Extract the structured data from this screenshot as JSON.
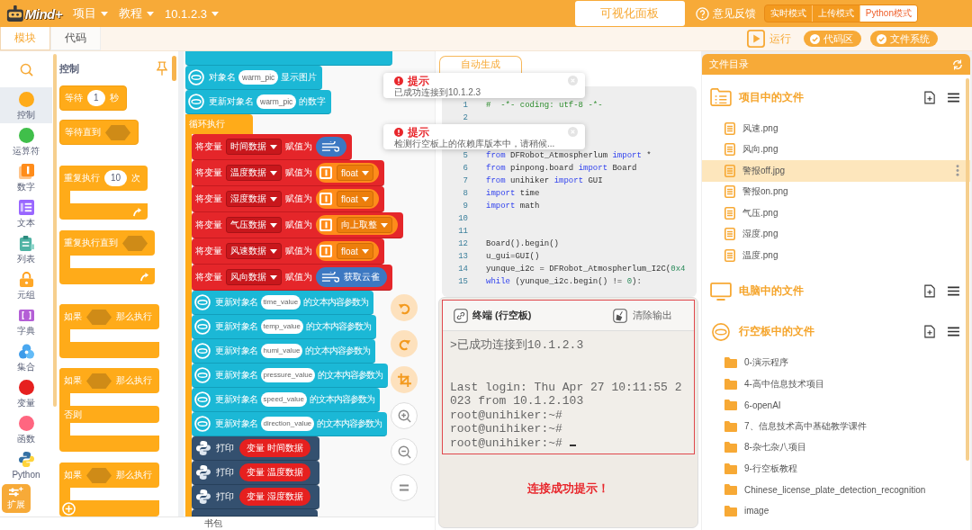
{
  "header": {
    "logo": "Mind+",
    "menus": [
      {
        "label": "项目"
      },
      {
        "label": "教程"
      },
      {
        "label": "10.1.2.3"
      }
    ],
    "panel_button": "可视化面板",
    "feedback": "意见反馈",
    "modes": [
      {
        "label": "实时模式",
        "selected": false
      },
      {
        "label": "上传模式",
        "selected": false
      },
      {
        "label": "Python模式",
        "selected": true
      }
    ]
  },
  "editor_tabs": [
    {
      "label": "模块",
      "selected": true
    },
    {
      "label": "代码",
      "selected": false
    }
  ],
  "toolbar": {
    "run": "运行",
    "toggles": [
      {
        "label": "代码区",
        "checked": true
      },
      {
        "label": "文件系统",
        "checked": true
      }
    ]
  },
  "categories": [
    {
      "kind": "dot",
      "label": "控制",
      "color": "#ffab19",
      "selected": true
    },
    {
      "kind": "dot",
      "label": "运算符",
      "color": "#40bf4a",
      "selected": false
    },
    {
      "kind": "number",
      "label": "数字",
      "selected": false
    },
    {
      "kind": "text",
      "label": "文本",
      "selected": false
    },
    {
      "kind": "list",
      "label": "列表",
      "selected": false
    },
    {
      "kind": "tuple",
      "label": "元组",
      "selected": false
    },
    {
      "kind": "dict",
      "label": "字典",
      "selected": false
    },
    {
      "kind": "set",
      "label": "集合",
      "selected": false
    },
    {
      "kind": "dot",
      "label": "变量",
      "color": "#e6201f",
      "selected": false
    },
    {
      "kind": "dot",
      "label": "函数",
      "color": "#ff6680",
      "selected": false
    },
    {
      "kind": "python",
      "label": "Python",
      "selected": false
    }
  ],
  "extension_button": "扩展",
  "palette": {
    "title": "控制",
    "blocks": [
      {
        "kind": "wait",
        "label": "等待",
        "value": "1",
        "unit": "秒"
      },
      {
        "kind": "wait_until",
        "label": "等待直到"
      },
      {
        "kind": "repeat",
        "label": "重复执行",
        "value": "10",
        "unit": "次"
      },
      {
        "kind": "repeat_until",
        "label": "重复执行直到"
      },
      {
        "kind": "if",
        "label": "如果",
        "then": "那么执行"
      },
      {
        "kind": "if_else",
        "label": "如果",
        "then": "那么执行",
        "else": "否则"
      },
      {
        "kind": "if_add",
        "label": "如果",
        "then": "那么执行"
      }
    ]
  },
  "workspace": {
    "object_blocks": [
      {
        "label": "对象名",
        "value": "warm_pic",
        "action": "显示图片"
      },
      {
        "label": "更新对象名",
        "value": "warm_pic",
        "action": "的数字"
      }
    ],
    "loop": {
      "label": "循环执行",
      "assignments": [
        {
          "label": "将变量",
          "variable": "时间数据",
          "verb": "赋值为",
          "reporter": {
            "kind": "weather"
          }
        },
        {
          "label": "将变量",
          "variable": "温度数据",
          "verb": "赋值为",
          "reporter": {
            "kind": "convert",
            "option": "float"
          }
        },
        {
          "label": "将变量",
          "variable": "湿度数据",
          "verb": "赋值为",
          "reporter": {
            "kind": "convert",
            "option": "float"
          }
        },
        {
          "label": "将变量",
          "variable": "气压数据",
          "verb": "赋值为",
          "reporter": {
            "kind": "convert",
            "option": "向上取整"
          }
        },
        {
          "label": "将变量",
          "variable": "风速数据",
          "verb": "赋值为",
          "reporter": {
            "kind": "convert",
            "option": "float"
          }
        },
        {
          "label": "将变量",
          "variable": "风向数据",
          "verb": "赋值为",
          "reporter": {
            "kind": "weather",
            "text": "获取云雀"
          }
        }
      ],
      "updates": [
        {
          "label": "更新对象名",
          "value": "time_value",
          "action": "的文本内容参数为"
        },
        {
          "label": "更新对象名",
          "value": "temp_value",
          "action": "的文本内容参数为"
        },
        {
          "label": "更新对象名",
          "value": "humi_value",
          "action": "的文本内容参数为"
        },
        {
          "label": "更新对象名",
          "value": "pressure_value",
          "action": "的文本内容参数为"
        },
        {
          "label": "更新对象名",
          "value": "speed_value",
          "action": "的文本内容参数为"
        },
        {
          "label": "更新对象名",
          "value": "direction_value",
          "action": "的文本内容参数为"
        }
      ],
      "prints": [
        {
          "label": "打印",
          "prefix": "变量",
          "variable": "时间数据"
        },
        {
          "label": "打印",
          "prefix": "变量",
          "variable": "温度数据"
        },
        {
          "label": "打印",
          "prefix": "变量",
          "variable": "湿度数据"
        }
      ]
    }
  },
  "code": {
    "tab": "自动生成",
    "lines": [
      {
        "number": "1",
        "tokens": [
          {
            "kind": "comment",
            "text": "#  -*- coding: utf-8 -*-"
          }
        ]
      },
      {
        "number": "2"
      },
      {
        "number": "5",
        "tokens": [
          {
            "kind": "keyword",
            "text": "from"
          },
          {
            "kind": "plain",
            "text": " DFRobot_Atmospherlum "
          },
          {
            "kind": "keyword",
            "text": "import"
          },
          {
            "kind": "plain",
            "text": " *"
          }
        ]
      },
      {
        "number": "6",
        "tokens": [
          {
            "kind": "keyword",
            "text": "from"
          },
          {
            "kind": "plain",
            "text": " pinpong.board "
          },
          {
            "kind": "keyword",
            "text": "import"
          },
          {
            "kind": "plain",
            "text": " Board"
          }
        ]
      },
      {
        "number": "7",
        "tokens": [
          {
            "kind": "keyword",
            "text": "from"
          },
          {
            "kind": "plain",
            "text": " unihiker "
          },
          {
            "kind": "keyword",
            "text": "import"
          },
          {
            "kind": "plain",
            "text": " GUI"
          }
        ]
      },
      {
        "number": "8",
        "tokens": [
          {
            "kind": "keyword",
            "text": "import"
          },
          {
            "kind": "plain",
            "text": " time"
          }
        ]
      },
      {
        "number": "9",
        "tokens": [
          {
            "kind": "keyword",
            "text": "import"
          },
          {
            "kind": "plain",
            "text": " math"
          }
        ]
      },
      {
        "number": "10"
      },
      {
        "number": "11"
      },
      {
        "number": "12",
        "tokens": [
          {
            "kind": "plain",
            "text": "Board().begin()"
          }
        ]
      },
      {
        "number": "13",
        "tokens": [
          {
            "kind": "plain",
            "text": "u_gui=GUI()"
          }
        ]
      },
      {
        "number": "14",
        "tokens": [
          {
            "kind": "plain",
            "text": "yunque_i2c = DFRobot_Atmospherlum_I2C("
          },
          {
            "kind": "number",
            "text": "0x4"
          }
        ]
      },
      {
        "number": "15",
        "tokens": [
          {
            "kind": "keyword",
            "text": "while"
          },
          {
            "kind": "plain",
            "text": " (yunque_i2c.begin() != "
          },
          {
            "kind": "number",
            "text": "0"
          },
          {
            "kind": "plain",
            "text": "):"
          }
        ]
      }
    ]
  },
  "terminal": {
    "title": "终端 (行空板)",
    "clear_button": "清除输出",
    "lines": [
      {
        "kind": "text",
        "text": ">已成功连接到10.1.2.3",
        "cursor": false
      },
      {
        "kind": "blank"
      },
      {
        "kind": "blank"
      },
      {
        "kind": "text",
        "text": "Last login: Thu Apr 27 10:11:55 2023 from 10.1.2.103",
        "cursor": false
      },
      {
        "kind": "text",
        "text": "root@unihiker:~#",
        "cursor": false
      },
      {
        "kind": "text",
        "text": "root@unihiker:~#",
        "cursor": false
      },
      {
        "kind": "text",
        "text": "root@unihiker:~#",
        "cursor": true
      }
    ]
  },
  "annotation": "连接成功提示！",
  "files": {
    "title": "文件目录",
    "sections": [
      {
        "kind": "project",
        "title": "项目中的文件",
        "items": [
          {
            "kind": "file",
            "name": "风速.png",
            "selected": false
          },
          {
            "kind": "file",
            "name": "风向.png",
            "selected": false
          },
          {
            "kind": "file",
            "name": "警报off.jpg",
            "selected": true
          },
          {
            "kind": "file",
            "name": "警报on.png",
            "selected": false
          },
          {
            "kind": "file",
            "name": "气压.png",
            "selected": false
          },
          {
            "kind": "file",
            "name": "湿度.png",
            "selected": false
          },
          {
            "kind": "file",
            "name": "温度.png",
            "selected": false
          }
        ]
      },
      {
        "kind": "computer",
        "title": "电脑中的文件"
      },
      {
        "kind": "board",
        "title": "行空板中的文件",
        "items": [
          {
            "kind": "folder",
            "name": "0-演示程序",
            "selected": false
          },
          {
            "kind": "folder",
            "name": "4-高中信息技术项目",
            "selected": false
          },
          {
            "kind": "folder",
            "name": "6-openAI",
            "selected": false
          },
          {
            "kind": "folder",
            "name": "7、信息技术高中基础教学课件",
            "selected": false
          },
          {
            "kind": "folder",
            "name": "8-杂七杂八项目",
            "selected": false
          },
          {
            "kind": "folder",
            "name": "9-行空板教程",
            "selected": false
          },
          {
            "kind": "folder",
            "name": "Chinese_license_plate_detection_recognition",
            "selected": false
          },
          {
            "kind": "folder",
            "name": "image",
            "selected": false
          }
        ]
      }
    ]
  },
  "toasts": [
    {
      "title": "提示",
      "message": "已成功连接到10.1.2.3"
    },
    {
      "title": "提示",
      "message": "检测行空板上的依赖库版本中，请稍候..."
    }
  ],
  "backpack": "书包"
}
